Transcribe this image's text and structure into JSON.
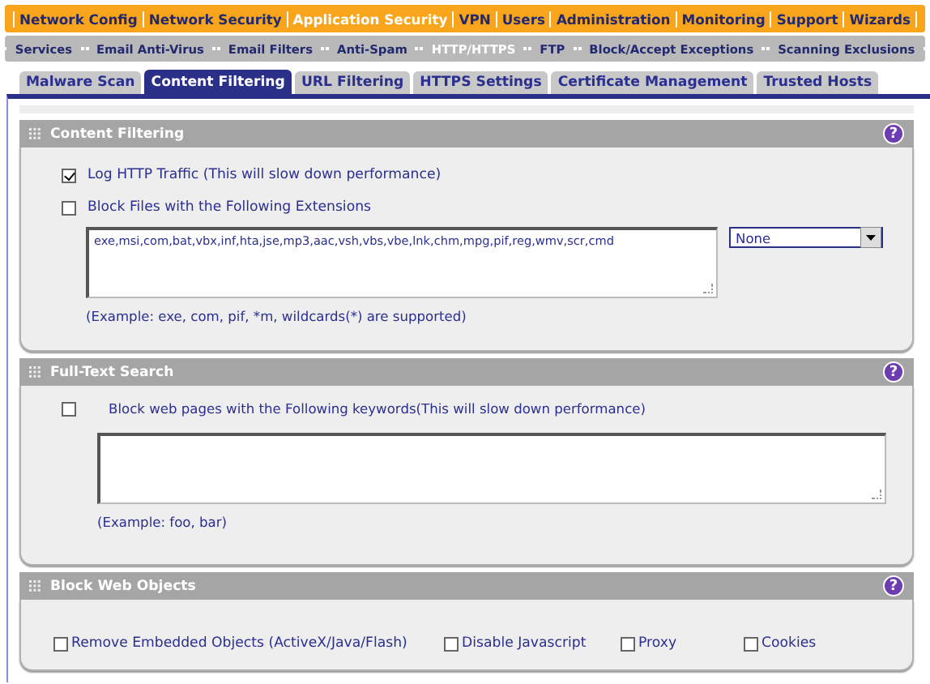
{
  "top_menu": [
    {
      "label": "Network Config",
      "selected": false
    },
    {
      "label": "Network Security",
      "selected": false
    },
    {
      "label": "Application Security",
      "selected": true
    },
    {
      "label": "VPN",
      "selected": false
    },
    {
      "label": "Users",
      "selected": false
    },
    {
      "label": "Administration",
      "selected": false
    },
    {
      "label": "Monitoring",
      "selected": false
    },
    {
      "label": "Support",
      "selected": false
    },
    {
      "label": "Wizards",
      "selected": false
    }
  ],
  "sub_menu": [
    {
      "label": "Services",
      "selected": false
    },
    {
      "label": "Email Anti-Virus",
      "selected": false
    },
    {
      "label": "Email Filters",
      "selected": false
    },
    {
      "label": "Anti-Spam",
      "selected": false
    },
    {
      "label": "HTTP/HTTPS",
      "selected": true
    },
    {
      "label": "FTP",
      "selected": false
    },
    {
      "label": "Block/Accept Exceptions",
      "selected": false
    },
    {
      "label": "Scanning Exclusions",
      "selected": false
    }
  ],
  "tabs": [
    {
      "label": "Malware Scan",
      "selected": false
    },
    {
      "label": "Content Filtering",
      "selected": true
    },
    {
      "label": "URL Filtering",
      "selected": false
    },
    {
      "label": "HTTPS Settings",
      "selected": false
    },
    {
      "label": "Certificate Management",
      "selected": false
    },
    {
      "label": "Trusted Hosts",
      "selected": false
    }
  ],
  "content_filtering": {
    "title": "Content Filtering",
    "help": "?",
    "log_http": {
      "label": "Log HTTP Traffic (This will slow down performance)",
      "checked": true
    },
    "block_files": {
      "label": "Block Files with the Following Extensions",
      "checked": false
    },
    "extensions": {
      "value": "exe,msi,com,bat,vbx,inf,hta,jse,mp3,aac,vsh,vbs,vbe,lnk,chm,mpg,pif,reg,wmv,scr,cmd"
    },
    "preset_select": {
      "value": "None"
    },
    "example": "(Example: exe, com, pif, *m, wildcards(*) are supported)"
  },
  "full_text_search": {
    "title": "Full-Text Search",
    "help": "?",
    "block_keywords": {
      "label": "Block web pages with the Following keywords(This will slow down performance)",
      "checked": false
    },
    "example": "(Example: foo, bar)"
  },
  "block_web_objects": {
    "title": "Block Web Objects",
    "help": "?",
    "options": [
      {
        "label": "Remove Embedded Objects (ActiveX/Java/Flash)",
        "checked": false
      },
      {
        "label": "Disable Javascript",
        "checked": false
      },
      {
        "label": "Proxy",
        "checked": false
      },
      {
        "label": "Cookies",
        "checked": false
      }
    ]
  }
}
